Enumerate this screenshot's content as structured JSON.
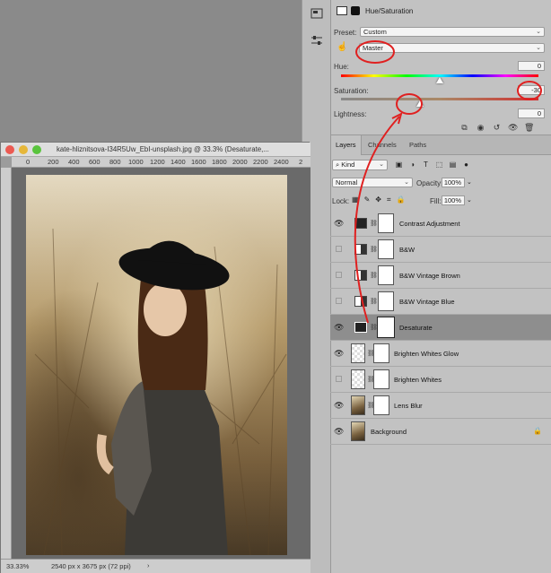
{
  "properties": {
    "title": "Hue/Saturation",
    "preset_label": "Preset:",
    "preset_value": "Custom",
    "channel_value": "Master",
    "hue_label": "Hue:",
    "hue_value": "0",
    "saturation_label": "Saturation:",
    "saturation_value": "-30",
    "saturation_level_percent": 40,
    "lightness_label": "Lightness:",
    "lightness_value": "0"
  },
  "layers_panel": {
    "tabs": [
      "Layers",
      "Channels",
      "Paths"
    ],
    "kind_label": "Kind",
    "blend_mode": "Normal",
    "opacity_label": "Opacity:",
    "opacity_value": "100%",
    "lock_label": "Lock:",
    "fill_label": "Fill:",
    "fill_value": "100%",
    "layers": [
      {
        "name": "Contrast Adjustment",
        "visible": true
      },
      {
        "name": "B&W",
        "visible": false
      },
      {
        "name": "B&W Vintage Brown",
        "visible": false
      },
      {
        "name": "B&W Vintage Blue",
        "visible": false
      },
      {
        "name": "Desaturate",
        "visible": true,
        "selected": true
      },
      {
        "name": "Brighten Whites Glow",
        "visible": true
      },
      {
        "name": "Brighten Whites",
        "visible": false
      },
      {
        "name": "Lens Blur",
        "visible": true
      },
      {
        "name": "Background",
        "visible": true,
        "locked": true
      }
    ]
  },
  "document": {
    "title": "kate-hliznitsova-I34R5Uw_EbI-unsplash.jpg @ 33.3% (Desaturate,...",
    "ruler_ticks": [
      "0",
      "200",
      "400",
      "600",
      "800",
      "1000",
      "1200",
      "1400",
      "1600",
      "1800",
      "2000",
      "2200",
      "2400",
      "2"
    ],
    "zoom": "33.33%",
    "doc_info": "2540 px x 3675 px (72 ppi)"
  },
  "colors": {
    "annotation": "#e02020",
    "panel_bg": "#c2c2c2",
    "selected_row": "#8e8e8e"
  }
}
